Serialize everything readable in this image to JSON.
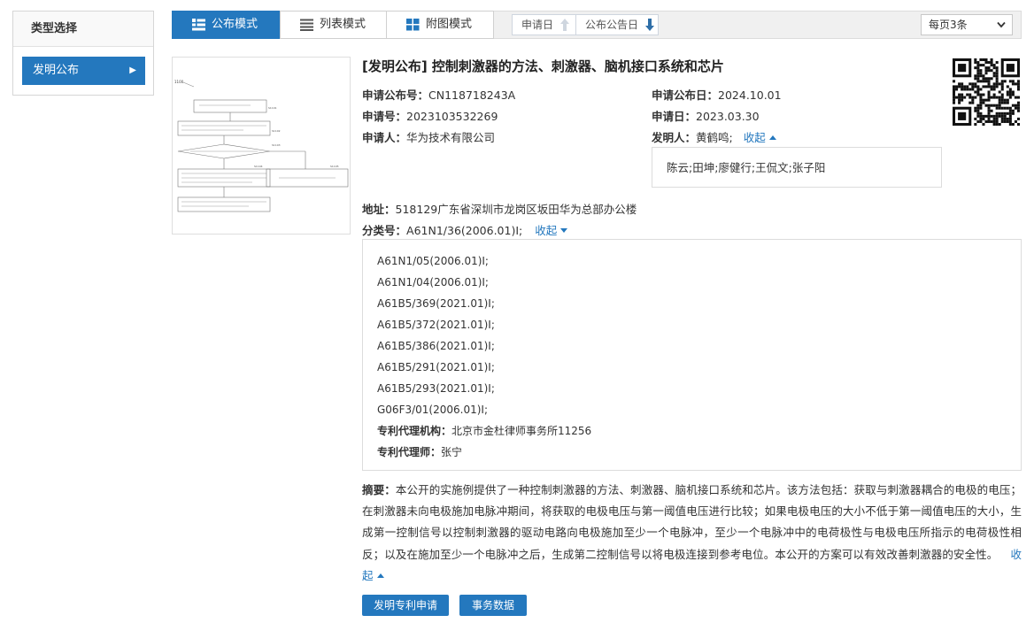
{
  "sidebar": {
    "title": "类型选择",
    "items": [
      {
        "label": "发明公布",
        "active": true
      }
    ]
  },
  "toolbar": {
    "modes": [
      {
        "label": "公布模式",
        "active": true,
        "icon": "list-detail-icon"
      },
      {
        "label": "列表模式",
        "active": false,
        "icon": "list-icon"
      },
      {
        "label": "附图模式",
        "active": false,
        "icon": "grid-icon"
      }
    ],
    "sorts": [
      {
        "label": "申请日",
        "direction": "up",
        "active": false
      },
      {
        "label": "公布公告日",
        "direction": "down",
        "active": true
      }
    ],
    "per_page": "每页3条"
  },
  "record": {
    "title": "[发明公布] 控制刺激器的方法、刺激器、脑机接口系统和芯片",
    "pub_no_label": "申请公布号：",
    "pub_no": "CN118718243A",
    "pub_date_label": "申请公布日：",
    "pub_date": "2024.10.01",
    "app_no_label": "申请号：",
    "app_no": "2023103532269",
    "app_date_label": "申请日：",
    "app_date": "2023.03.30",
    "applicant_label": "申请人：",
    "applicant": "华为技术有限公司",
    "inventor_label": "发明人：",
    "inventor": "黄鹤鸣;",
    "inventor_toggle": "收起",
    "inventors_more": "陈云;田坤;廖健行;王侃文;张子阳",
    "address_label": "地址：",
    "address": "518129广东省深圳市龙岗区坂田华为总部办公楼",
    "class_label": "分类号：",
    "class_main": "A61N1/36(2006.01)I;",
    "class_toggle": "收起",
    "classes": [
      "A61N1/05(2006.01)I;",
      "A61N1/04(2006.01)I;",
      "A61B5/369(2021.01)I;",
      "A61B5/372(2021.01)I;",
      "A61B5/386(2021.01)I;",
      "A61B5/291(2021.01)I;",
      "A61B5/293(2021.01)I;",
      "G06F3/01(2006.01)I;"
    ],
    "agency_label": "专利代理机构：",
    "agency": "北京市金杜律师事务所11256",
    "agent_label": "专利代理师：",
    "agent": "张宁",
    "abstract_label": "摘要：",
    "abstract": "本公开的实施例提供了一种控制刺激器的方法、刺激器、脑机接口系统和芯片。该方法包括：获取与刺激器耦合的电极的电压；在刺激器未向电极施加电脉冲期间，将获取的电极电压与第一阈值电压进行比较；如果电极电压的大小不低于第一阈值电压的大小，生成第一控制信号以控制刺激器的驱动电路向电极施加至少一个电脉冲，至少一个电脉冲中的电荷极性与电极电压所指示的电荷极性相反；以及在施加至少一个电脉冲之后，生成第二控制信号以将电极连接到参考电位。本公开的方案可以有效改善刺激器的安全性。",
    "abstract_toggle": "收起"
  },
  "figure": {
    "figure_label": "1100",
    "step_labels": [
      "S1101",
      "S1102",
      "S1103",
      "S1104",
      "S1105"
    ]
  },
  "actions": [
    {
      "label": "发明专利申请"
    },
    {
      "label": "事务数据"
    }
  ],
  "colors": {
    "accent": "#2478be",
    "border": "#dcdcdc",
    "toolbar_bg": "#f0f0f0"
  }
}
